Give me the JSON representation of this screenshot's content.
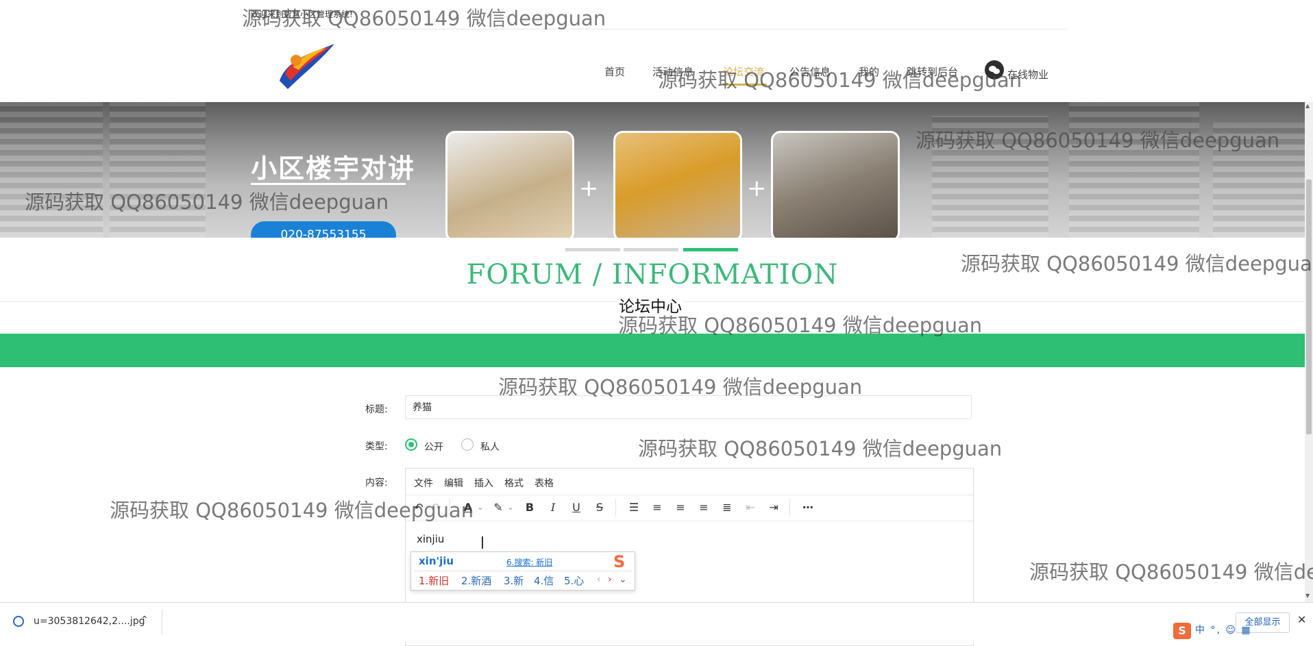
{
  "header": {
    "site_title": "欢迎来到智慧小区管理系统!",
    "nav": [
      "首页",
      "活动信息",
      "论坛交流",
      "公告信息",
      "我的",
      "跳转到后台"
    ],
    "active_nav_index": 2,
    "service_label": "在线物业"
  },
  "banner": {
    "title": "小区楼宇对讲",
    "phone": "020-87553155",
    "plus": "+",
    "active_slide": 3,
    "slide_count": 3
  },
  "section": {
    "title": "FORUM / INFORMATION",
    "subtitle": "论坛中心"
  },
  "form": {
    "title_label": "标题:",
    "title_value": "养猫",
    "type_label": "类型:",
    "type_options": [
      "公开",
      "私人"
    ],
    "type_selected": "公开",
    "content_label": "内容:"
  },
  "editor": {
    "menu": [
      "文件",
      "编辑",
      "插入",
      "格式",
      "表格"
    ],
    "toolbar": [
      "undo",
      "redo",
      "text-color",
      "highlight",
      "B",
      "I",
      "U",
      "S",
      "ordered-list",
      "align-left",
      "align-center",
      "align-right",
      "align-justify",
      "outdent",
      "indent",
      "more"
    ],
    "content": "xinjiu"
  },
  "ime": {
    "pinyin": "xin'jiu",
    "search": "6.搜索: 新旧",
    "candidates": [
      "1.新旧",
      "2.新酒",
      "3.新",
      "4.信",
      "5.心"
    ],
    "logo": "S"
  },
  "download_bar": {
    "file_name": "u=3053812642,2....jpg",
    "show_all": "全部显示",
    "tray": "中 °, ☺ ▦"
  },
  "watermark": "源码获取 QQ86050149 微信deepguan"
}
